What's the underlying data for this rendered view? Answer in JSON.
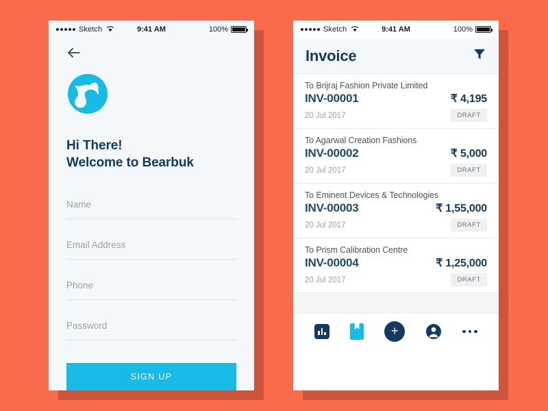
{
  "background_color": "#fa6a4b",
  "accent_cyan": "#16bbe8",
  "accent_navy": "#123a63",
  "status_bar": {
    "carrier": "Sketch",
    "time": "9:41 AM",
    "battery_percent": "100%",
    "wifi_icon": "wifi-icon",
    "signal_icon": "signal-dots-icon",
    "battery_icon": "battery-full-icon"
  },
  "signup_screen": {
    "back_icon": "back-arrow-icon",
    "logo_icon": "bear-logo-icon",
    "greeting_line1": "Hi There!",
    "greeting_line2": "Welcome to Bearbuk",
    "fields": [
      {
        "name": "name",
        "placeholder": "Name",
        "value": ""
      },
      {
        "name": "email",
        "placeholder": "Email Address",
        "value": ""
      },
      {
        "name": "phone",
        "placeholder": "Phone",
        "value": ""
      },
      {
        "name": "password",
        "placeholder": "Password",
        "value": ""
      }
    ],
    "submit_label": "SIGN UP"
  },
  "invoice_screen": {
    "title": "Invoice",
    "filter_icon": "filter-funnel-icon",
    "invoices": [
      {
        "to": "To Brijraj Fashion Private Limited",
        "number": "INV-00001",
        "amount": "₹ 4,195",
        "date": "20 Jul 2017",
        "status": "DRAFT"
      },
      {
        "to": "To Agarwal Creation Fashions",
        "number": "INV-00002",
        "amount": "₹ 5,000",
        "date": "20 Jul 2017",
        "status": "DRAFT"
      },
      {
        "to": "To Eminent Devices & Technologies",
        "number": "INV-00003",
        "amount": "₹ 1,55,000",
        "date": "20 Jul 2017",
        "status": "DRAFT"
      },
      {
        "to": "To Prism Calibration Centre",
        "number": "INV-00004",
        "amount": "₹ 1,25,000",
        "date": "20 Jul 2017",
        "status": "DRAFT"
      }
    ],
    "tabbar": [
      {
        "name": "reports",
        "icon": "bar-chart-icon"
      },
      {
        "name": "ledger",
        "icon": "book-bookmark-icon"
      },
      {
        "name": "create",
        "icon": "plus-circle-icon"
      },
      {
        "name": "contacts",
        "icon": "person-circle-icon"
      },
      {
        "name": "more",
        "icon": "more-dots-icon"
      }
    ]
  }
}
